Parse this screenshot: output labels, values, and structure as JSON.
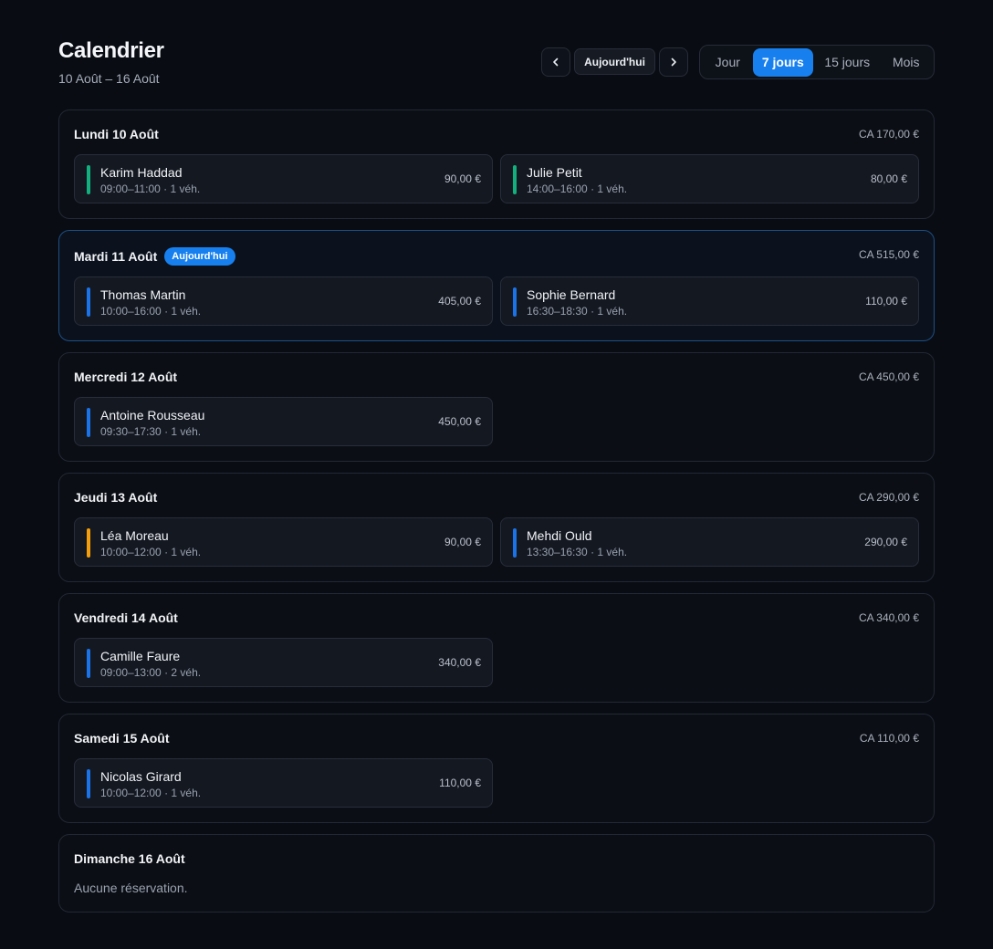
{
  "header": {
    "title": "Calendrier",
    "range": "10 Août – 16 Août",
    "today_label": "Aujourd'hui",
    "prev_icon": "chevron-left-icon",
    "next_icon": "chevron-right-icon",
    "views": [
      "Jour",
      "7 jours",
      "15 jours",
      "Mois"
    ],
    "active_view": "7 jours"
  },
  "colors": {
    "accent": "#1780ee",
    "green": "#12b07c",
    "blue": "#1a73e8",
    "orange": "#f59e0b"
  },
  "days": [
    {
      "title": "Lundi 10 Août",
      "ca": "CA 170,00 €",
      "reservations": [
        {
          "name": "Karim Haddad",
          "meta": "09:00–11:00 · 1 véh.",
          "price": "90,00 €",
          "color": "#12b07c"
        },
        {
          "name": "Julie Petit",
          "meta": "14:00–16:00 · 1 véh.",
          "price": "80,00 €",
          "color": "#12b07c"
        }
      ]
    },
    {
      "title": "Mardi 11 Août",
      "badge": "Aujourd'hui",
      "ca": "CA 515,00 €",
      "reservations": [
        {
          "name": "Thomas Martin",
          "meta": "10:00–16:00 · 1 véh.",
          "price": "405,00 €",
          "color": "#1a73e8"
        },
        {
          "name": "Sophie Bernard",
          "meta": "16:30–18:30 · 1 véh.",
          "price": "110,00 €",
          "color": "#1a73e8"
        }
      ]
    },
    {
      "title": "Mercredi 12 Août",
      "ca": "CA 450,00 €",
      "reservations": [
        {
          "name": "Antoine Rousseau",
          "meta": "09:30–17:30 · 1 véh.",
          "price": "450,00 €",
          "color": "#1a73e8"
        }
      ]
    },
    {
      "title": "Jeudi 13 Août",
      "ca": "CA 290,00 €",
      "reservations": [
        {
          "name": "Léa Moreau",
          "meta": "10:00–12:00 · 1 véh.",
          "price": "90,00 €",
          "color": "#f59e0b"
        },
        {
          "name": "Mehdi Ould",
          "meta": "13:30–16:30 · 1 véh.",
          "price": "290,00 €",
          "color": "#1a73e8"
        }
      ]
    },
    {
      "title": "Vendredi 14 Août",
      "ca": "CA 340,00 €",
      "reservations": [
        {
          "name": "Camille Faure",
          "meta": "09:00–13:00 · 2 véh.",
          "price": "340,00 €",
          "color": "#1a73e8"
        }
      ]
    },
    {
      "title": "Samedi 15 Août",
      "ca": "CA 110,00 €",
      "reservations": [
        {
          "name": "Nicolas Girard",
          "meta": "10:00–12:00 · 1 véh.",
          "price": "110,00 €",
          "color": "#1a73e8"
        }
      ]
    },
    {
      "title": "Dimanche 16 Août",
      "empty": "Aucune réservation."
    }
  ]
}
